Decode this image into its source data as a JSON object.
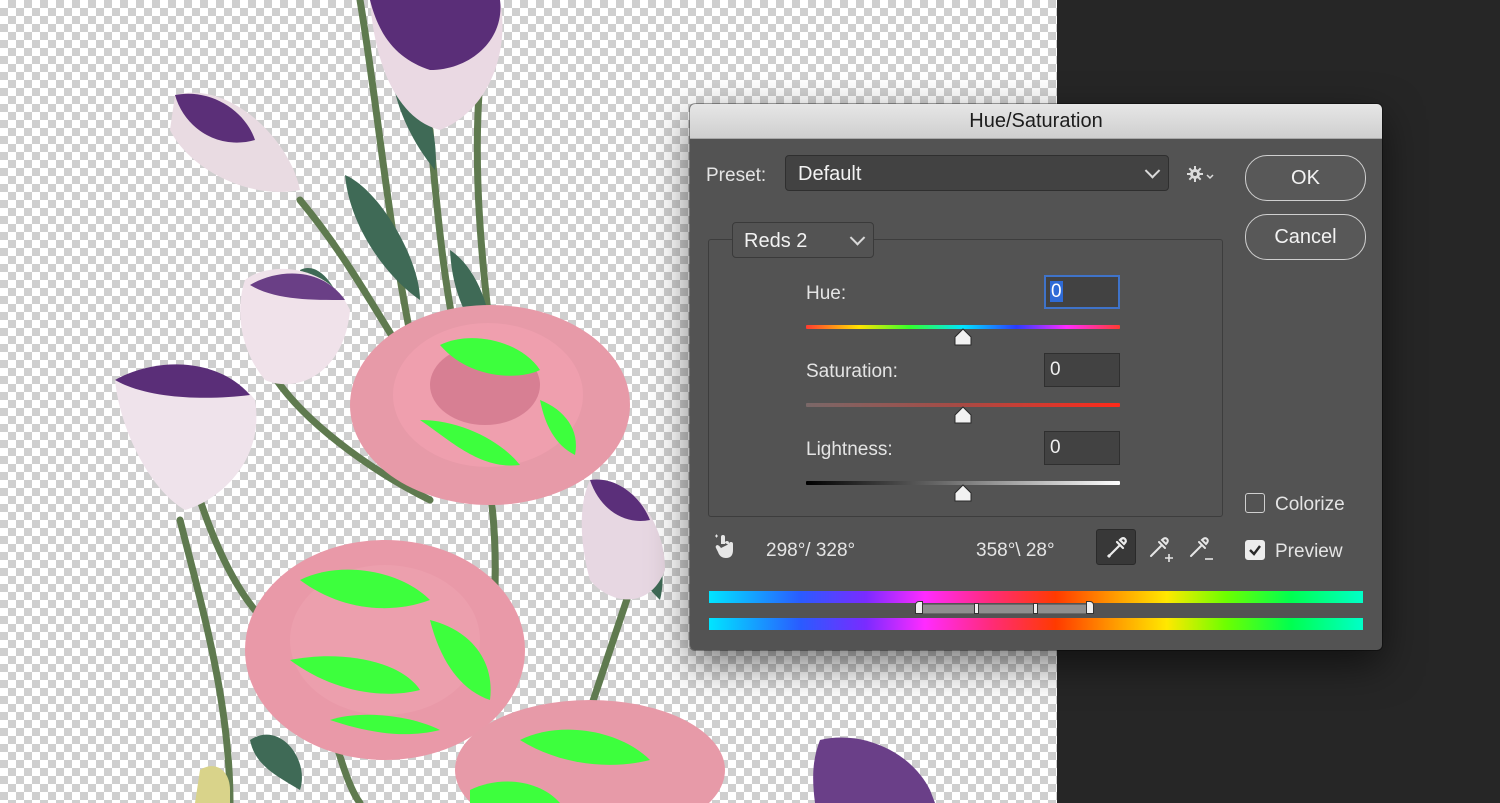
{
  "dialog": {
    "title": "Hue/Saturation",
    "preset_label": "Preset:",
    "preset_value": "Default",
    "ok_label": "OK",
    "cancel_label": "Cancel",
    "channel_value": "Reds 2",
    "hue": {
      "label": "Hue:",
      "value": "0",
      "position": 0.5
    },
    "saturation": {
      "label": "Saturation:",
      "value": "0",
      "position": 0.5
    },
    "lightness": {
      "label": "Lightness:",
      "value": "0",
      "position": 0.5
    },
    "range_left": "298°/ 328°",
    "range_right": "358°\\ 28°",
    "colorize_label": "Colorize",
    "colorize_checked": false,
    "preview_label": "Preview",
    "preview_checked": true
  },
  "icons": {
    "settings": "gear-icon",
    "hand": "targeted-adjustment-hand-icon",
    "eyedropper": "eyedropper-icon",
    "eyedropper_add": "eyedropper-plus-icon",
    "eyedropper_subtract": "eyedropper-minus-icon"
  },
  "colors": {
    "dialog_bg": "#535353",
    "field_bg": "#424242",
    "focus": "#3f73c9",
    "highlight_green": "#3dff3d",
    "rose_pink": "#e9a2ac",
    "lisianthus_purple": "#5a2e78"
  }
}
